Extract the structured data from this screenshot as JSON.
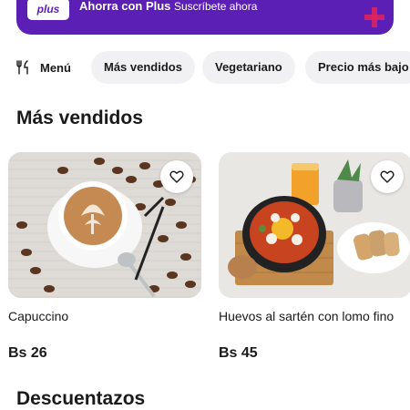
{
  "plus_banner": {
    "logo_text": "plus",
    "title": "Ahorra con Plus",
    "subtitle": "Suscríbete ahora"
  },
  "chips": {
    "menu_label": "Menú",
    "items": [
      "Más vendidos",
      "Vegetariano",
      "Precio más bajo"
    ]
  },
  "sections": {
    "best_sellers": "Más vendidos",
    "discounts": "Descuentazos"
  },
  "products": [
    {
      "name": "Capuccino",
      "price": "Bs 26",
      "icon": "heart-outline-icon"
    },
    {
      "name": "Huevos al sartén con lomo fino",
      "price": "Bs 45",
      "icon": "heart-outline-icon"
    }
  ],
  "colors": {
    "brand_purple": "#5b1fb5",
    "accent_pink": "#e0245e",
    "chip_bg": "#f1f1f3"
  }
}
